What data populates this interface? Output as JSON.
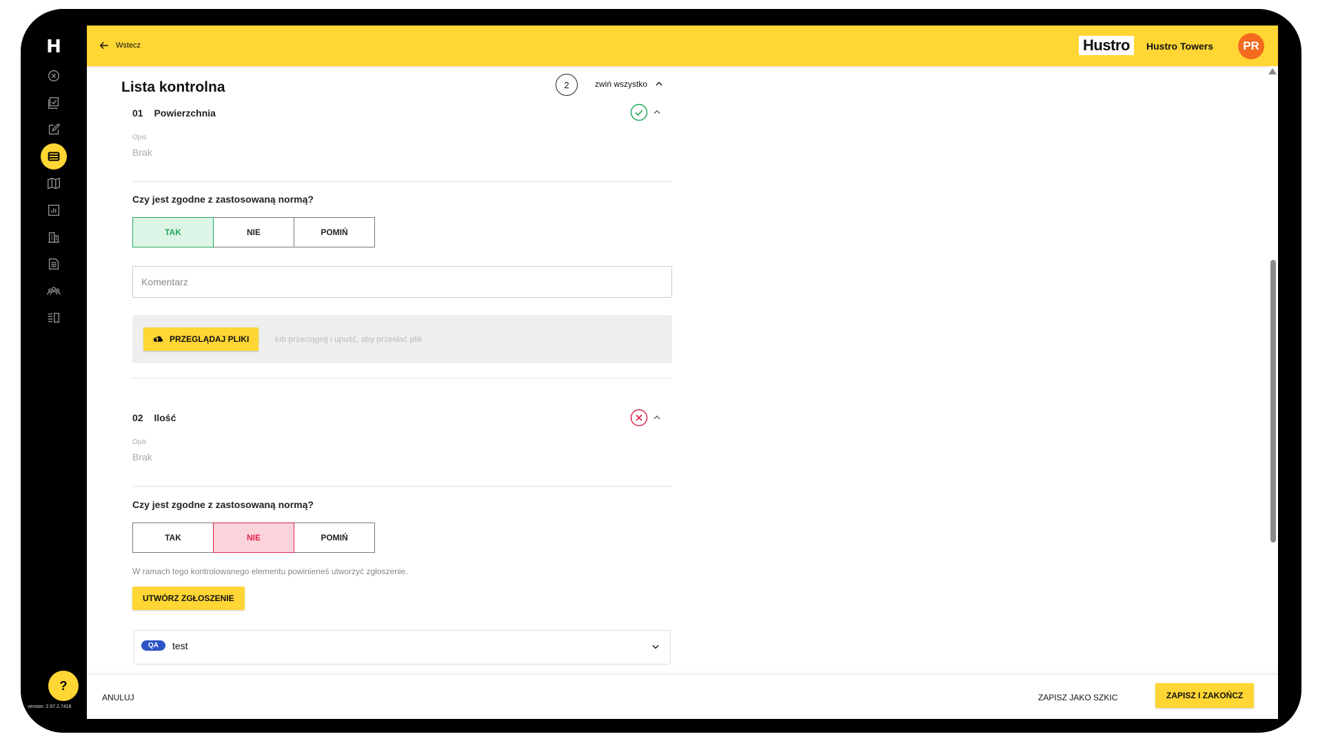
{
  "sidebar": {
    "logo": "H",
    "help_label": "?",
    "version": "version: 2.97.2.7418",
    "items": [
      {
        "icon": "close-circle-icon"
      },
      {
        "icon": "checklist-icon"
      },
      {
        "icon": "edit-square-icon"
      },
      {
        "icon": "inspection-list-icon",
        "active": true
      },
      {
        "icon": "map-icon"
      },
      {
        "icon": "chart-icon"
      },
      {
        "icon": "building-icon"
      },
      {
        "icon": "document-icon"
      },
      {
        "icon": "team-icon"
      },
      {
        "icon": "list-view-icon"
      }
    ]
  },
  "topbar": {
    "back_label": "Wstecz",
    "brand": "Hustro",
    "org_name": "Hustro Towers",
    "avatar_initials": "PR"
  },
  "checklist": {
    "title": "Lista kontrolna",
    "count": "2",
    "collapse_all": "zwiń wszystko",
    "items": [
      {
        "number": "01",
        "name": "Powierzchnia",
        "status": "ok",
        "description_label": "Opis",
        "description_value": "Brak",
        "question": "Czy jest zgodne z zastosowaną normą?",
        "options": [
          "TAK",
          "NIE",
          "POMIŃ"
        ],
        "selected": "TAK",
        "comment_placeholder": "Komentarz",
        "browse_label": "PRZEGLĄDAJ PLIKI",
        "upload_hint": "lub przeciągnij i upuść, aby przesłać plik"
      },
      {
        "number": "02",
        "name": "Ilość",
        "status": "failed",
        "description_label": "Opis",
        "description_value": "Brak",
        "question": "Czy jest zgodne z zastosowaną normą?",
        "options": [
          "TAK",
          "NIE",
          "POMIŃ"
        ],
        "selected": "NIE",
        "warning": "W ramach tego kontrolowanego elementu powinieneś utworzyć zgłoszenie.",
        "create_label": "UTWÓRZ ZGŁOSZENIE",
        "issue": {
          "tag": "QA",
          "name": "test"
        }
      }
    ]
  },
  "footer": {
    "cancel_label": "ANULUJ",
    "draft_label": "ZAPISZ JAKO SZKIC",
    "finish_label": "ZAPISZ I ZAKOŃCZ"
  },
  "colors": {
    "accent": "#FFD633",
    "success": "#1FA85A",
    "danger": "#E0234B",
    "avatar": "#F46A1E",
    "tag": "#2D54C4"
  }
}
